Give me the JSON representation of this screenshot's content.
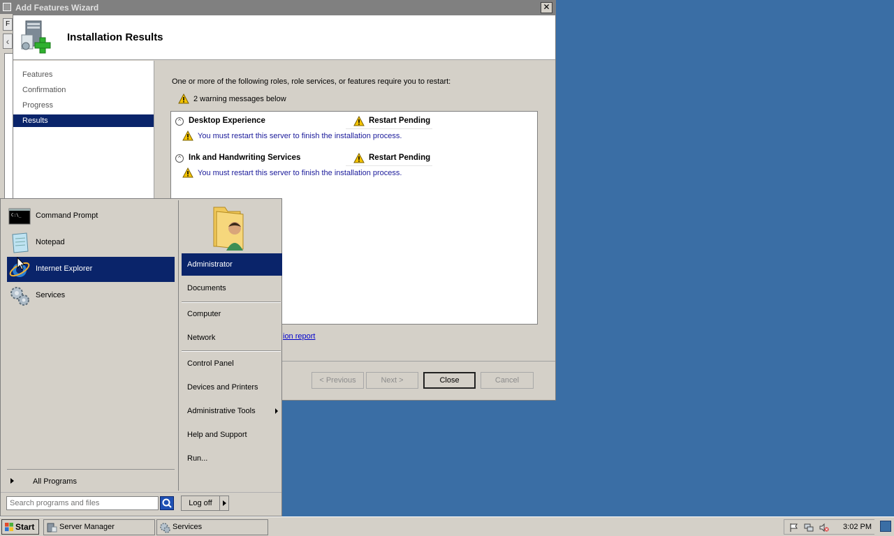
{
  "wizard": {
    "title": "Add Features Wizard",
    "heading": "Installation Results",
    "side_items": [
      "Features",
      "Confirmation",
      "Progress",
      "Results"
    ],
    "active_side_item": "Results",
    "intro": "One or more of the following roles, role services, or features require you to restart:",
    "warning_summary": "2 warning messages below",
    "results": [
      {
        "name": "Desktop Experience",
        "status": "Restart Pending",
        "message": "You must restart this server to finish the installation process."
      },
      {
        "name": "Ink and Handwriting Services",
        "status": "Restart Pending",
        "message": "You must restart this server to finish the installation process."
      }
    ],
    "report_link": "ion report",
    "buttons": {
      "previous": "< Previous",
      "next": "Next >",
      "close": "Close",
      "cancel": "Cancel"
    }
  },
  "start_menu": {
    "programs": [
      "Command Prompt",
      "Notepad",
      "Internet Explorer",
      "Services"
    ],
    "selected_program": "Internet Explorer",
    "all_programs": "All Programs",
    "right_items": {
      "administrator": "Administrator",
      "documents": "Documents",
      "computer": "Computer",
      "network": "Network",
      "control_panel": "Control Panel",
      "devices": "Devices and Printers",
      "admin_tools": "Administrative Tools",
      "help": "Help and Support",
      "run": "Run..."
    },
    "search_placeholder": "Search programs and files",
    "log_off": "Log off"
  },
  "taskbar": {
    "start": "Start",
    "tasks": [
      "Server Manager",
      "Services"
    ],
    "clock": "3:02 PM"
  },
  "colors": {
    "desktop": "#3a6ea5",
    "selection": "#0a246a",
    "warning": "#f5c400"
  }
}
